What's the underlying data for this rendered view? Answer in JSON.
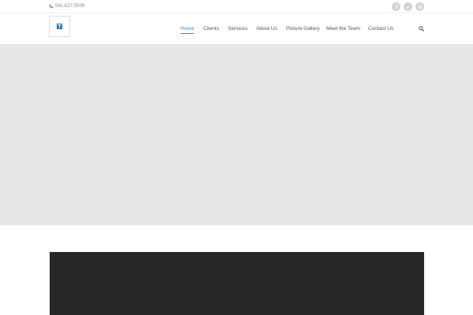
{
  "topbar": {
    "phone": "561-627-5539",
    "phone_icon": "phone-icon",
    "social": [
      "facebook-icon",
      "google-plus-icon",
      "instagram-icon"
    ]
  },
  "header": {
    "logo_icon": "logo-icon",
    "nav": [
      {
        "label": "Home",
        "active": true
      },
      {
        "label": "Clients",
        "active": false
      },
      {
        "label": "Services",
        "active": false
      },
      {
        "label": "About Us",
        "active": false
      },
      {
        "label": "Picture Gallery",
        "active": false
      },
      {
        "label": "Meet the Team",
        "active": false
      },
      {
        "label": "Contact Us",
        "active": false
      }
    ],
    "search_icon": "search-icon"
  },
  "colors": {
    "accent": "#2a8fd0",
    "hero_bg": "#e7e7e7",
    "dark_block": "#272727",
    "social_bg": "#d3d3d3"
  }
}
